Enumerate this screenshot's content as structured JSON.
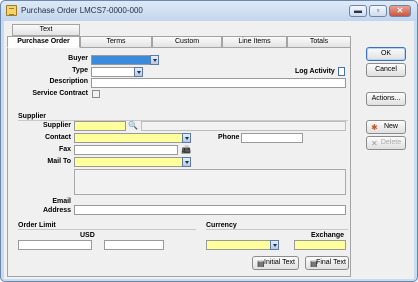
{
  "window": {
    "title": "Purchase Order LMCS7-0000-000"
  },
  "titlebar_buttons": {
    "minimize": "▬",
    "restore": "▫",
    "close": "✕"
  },
  "top_tab": "Text",
  "tabs": [
    {
      "label": "Purchase Order",
      "active": true
    },
    {
      "label": "Terms",
      "active": false
    },
    {
      "label": "Custom",
      "active": false
    },
    {
      "label": "Line Items",
      "active": false
    },
    {
      "label": "Totals",
      "active": false
    }
  ],
  "form": {
    "buyer_label": "Buyer",
    "type_label": "Type",
    "log_activity_label": "Log Activity",
    "description_label": "Description",
    "service_contract_label": "Service Contract",
    "supplier_section": "Supplier",
    "supplier_label": "Supplier",
    "contact_label": "Contact",
    "phone_label": "Phone",
    "fax_label": "Fax",
    "mail_to_label": "Mail To",
    "email_label_1": "Email",
    "email_label_2": "Address",
    "order_limit_section": "Order Limit",
    "usd_label": "USD",
    "currency_section": "Currency",
    "exchange_label": "Exchange",
    "initial_text_button": "Initial Text",
    "final_text_button": "Final Text"
  },
  "side_buttons": {
    "ok": "OK",
    "cancel": "Cancel",
    "actions": "Actions...",
    "new": "New",
    "delete": "Delete"
  },
  "colors": {
    "required_field": "#ffff9c",
    "selected_field": "#3a8bdb",
    "window_frame": "#c9dbef"
  }
}
